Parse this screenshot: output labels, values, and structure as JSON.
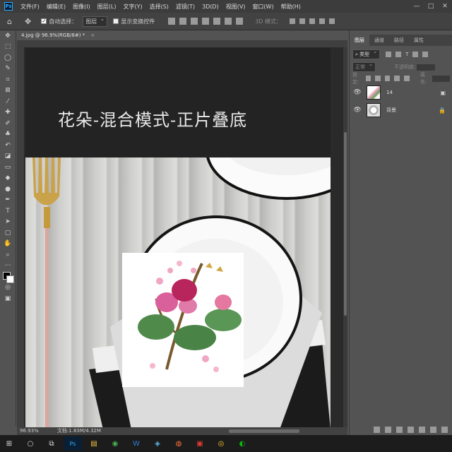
{
  "app": {
    "logo": "Ps"
  },
  "menu": [
    "文件(F)",
    "编辑(E)",
    "图像(I)",
    "图层(L)",
    "文字(Y)",
    "选择(S)",
    "滤镜(T)",
    "3D(D)",
    "视图(V)",
    "窗口(W)",
    "帮助(H)"
  ],
  "window_controls": [
    "—",
    "□",
    "✕"
  ],
  "options": {
    "auto_select_label": "自动选择：",
    "auto_select_value": "图层",
    "show_transform_label": "显示变换控件",
    "mode_3d": "3D 模式："
  },
  "doc_tab": {
    "title": "4.jpg @ 96.9%(RGB/8#) *",
    "close": "×"
  },
  "canvas": {
    "heading": "花朵-混合模式-正片叠底"
  },
  "status": {
    "zoom": "96.93%",
    "doc_info": "文档:1.83M/4.32M"
  },
  "panel": {
    "tabs": [
      "图层",
      "通道",
      "路径",
      "属性"
    ],
    "filter_kind": "类型",
    "blend_mode": "正常",
    "opacity_label": "不透明度:",
    "lock_label": "锁定:",
    "fill_label": "填充:",
    "layers": [
      {
        "name": "14",
        "locked": false
      },
      {
        "name": "背景",
        "locked": true
      }
    ]
  },
  "colors": {
    "accent": "#31a8ff",
    "bg": "#535353",
    "menubar": "#3c3c3c"
  },
  "taskbar": [
    "⊞",
    "○",
    "⧉",
    "Ps",
    "▤",
    "◉",
    "W",
    "◈",
    "◍",
    "▣",
    "◎",
    "◐"
  ]
}
